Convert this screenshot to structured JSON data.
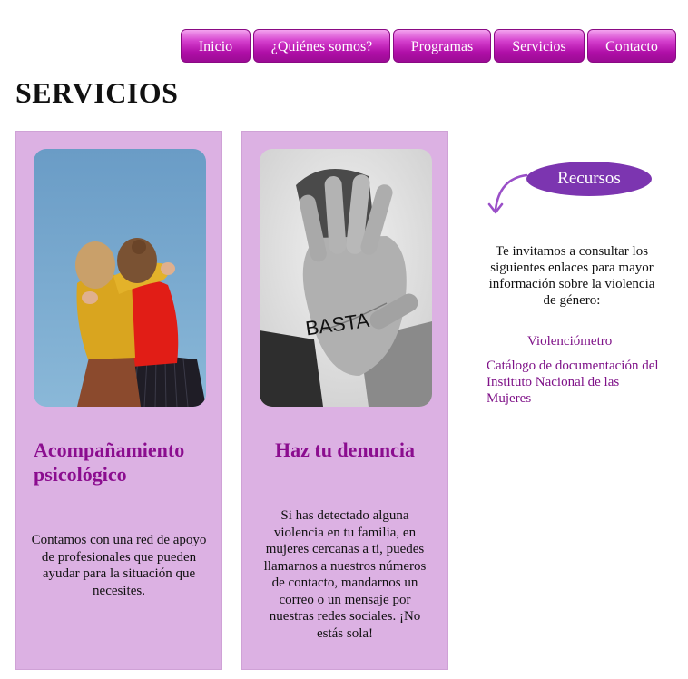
{
  "nav": {
    "items": [
      {
        "label": "Inicio"
      },
      {
        "label": "¿Quiénes somos?"
      },
      {
        "label": "Programas"
      },
      {
        "label": "Servicios"
      },
      {
        "label": "Contacto"
      }
    ]
  },
  "page": {
    "title": "SERVICIOS"
  },
  "cards": [
    {
      "title": "Acompañamiento psicológico",
      "text": "Contamos con una red de apoyo de profesionales que pueden ayudar para la situación que necesites."
    },
    {
      "title": "Haz tu denuncia",
      "text": "Si has detectado alguna violencia en tu familia, en mujeres cercanas a ti, puedes llamarnos a nuestros números de contacto, mandarnos un correo o un mensaje por nuestras redes sociales. ¡No estás sola!",
      "image_text": "BASTA"
    }
  ],
  "sidebar": {
    "resources_label": "Recursos",
    "intro": "Te invitamos a consultar los siguientes enlaces para mayor información sobre la violencia de género:",
    "links": [
      {
        "label": "Violenciómetro"
      },
      {
        "label": "Catálogo de documentación del Instituto Nacional de las Mujeres"
      }
    ]
  },
  "colors": {
    "accent": "#8b0d8f",
    "card_bg": "#dcb1e3",
    "resources_bg": "#7c35b0",
    "nav_bg": "#b00fa8"
  }
}
